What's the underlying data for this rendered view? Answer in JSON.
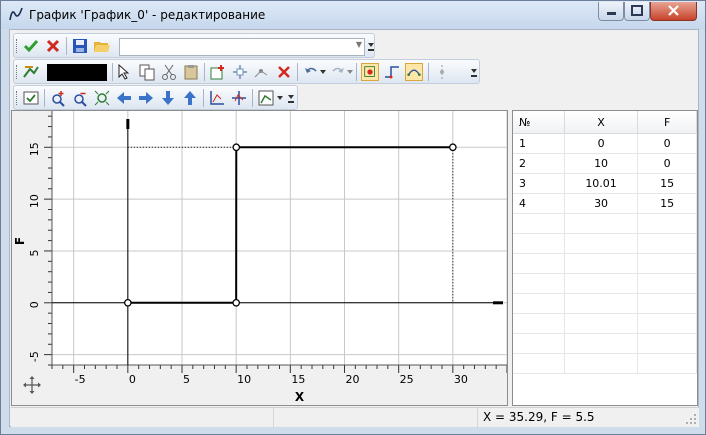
{
  "window": {
    "title": "График 'График_0' - редактирование"
  },
  "toolbar1": {
    "combo_value": ""
  },
  "toolbar2": {
    "color": "#000000"
  },
  "chart_data": {
    "type": "line",
    "xlabel": "X",
    "ylabel": "F",
    "xlim": [
      -7,
      35
    ],
    "ylim": [
      -6,
      18.5
    ],
    "x_ticks": [
      "-5",
      "0",
      "5",
      "10",
      "15",
      "20",
      "25",
      "30"
    ],
    "y_ticks": [
      "-5",
      "0",
      "5",
      "10",
      "15"
    ],
    "series": [
      {
        "x": [
          0,
          10,
          10.01,
          30
        ],
        "y": [
          0,
          0,
          15,
          15
        ]
      }
    ],
    "grid": true
  },
  "table": {
    "headers": [
      "№",
      "X",
      "F"
    ],
    "rows": [
      [
        "1",
        "0",
        "0"
      ],
      [
        "2",
        "10",
        "0"
      ],
      [
        "3",
        "10.01",
        "15"
      ],
      [
        "4",
        "30",
        "15"
      ]
    ]
  },
  "status": {
    "coords": "X = 35.29, F = 5.5"
  },
  "colors": {
    "accent_check": "#2ca02c",
    "close_red": "#c7432a",
    "arrow_blue": "#3a73c8"
  }
}
